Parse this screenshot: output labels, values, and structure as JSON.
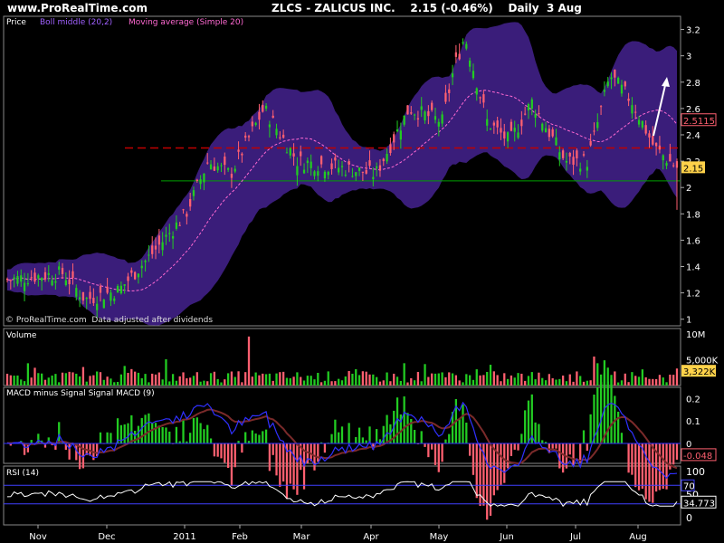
{
  "header": {
    "site": "www.ProRealTime.com",
    "title": "ZLCS - ZALICUS INC.    2.15 (-0.46%)    Daily  3 Aug"
  },
  "panels": {
    "price": {
      "label": "Price",
      "legend": [
        "Boll middle (20,2)",
        "Moving average (Simple 20)"
      ],
      "footer": "© ProRealTime.com  Data adjusted after dividends",
      "last_value": "2.15",
      "boll_value": "2.5115",
      "yticks": [
        "3.2",
        "3",
        "2.8",
        "2.6",
        "2.4",
        "2.2",
        "2",
        "1.8",
        "1.6",
        "1.4",
        "1.2",
        "1"
      ]
    },
    "volume": {
      "label": "Volume",
      "scale_label": "10M",
      "scale_label2": "5,000K",
      "last_value": "3,322K"
    },
    "macd": {
      "label": "MACD minus Signal Signal MACD (9)",
      "yticks": [
        "0.2",
        "0.1",
        "0"
      ],
      "last_value": "-0.048"
    },
    "rsi": {
      "label": "RSI (14)",
      "yticks": [
        "100",
        "50",
        "0"
      ],
      "level_label": "70",
      "last_value": "34.773"
    },
    "xaxis": [
      "Nov",
      "Dec",
      "2011",
      "Feb",
      "Mar",
      "Apr",
      "May",
      "Jun",
      "Jul",
      "Aug"
    ]
  },
  "chart_data": {
    "type": "candlestick",
    "ylim": [
      0.95,
      3.3
    ],
    "hlines": [
      {
        "value": 2.3,
        "color": "#c00000",
        "style": "dashed"
      },
      {
        "value": 2.05,
        "color": "#00a000",
        "style": "solid"
      }
    ],
    "close_series_key_points": [
      {
        "date": "Nov",
        "close": 1.3
      },
      {
        "date": "mid Nov",
        "close": 1.2
      },
      {
        "date": "Dec",
        "close": 1.25
      },
      {
        "date": "mid Dec",
        "close": 1.45
      },
      {
        "date": "Jan",
        "close": 2.0
      },
      {
        "date": "Feb",
        "close": 2.3
      },
      {
        "date": "Mar",
        "close": 2.1
      },
      {
        "date": "Apr",
        "close": 2.3
      },
      {
        "date": "late Apr",
        "close": 3.1
      },
      {
        "date": "May",
        "close": 2.5
      },
      {
        "date": "Jun",
        "close": 2.3
      },
      {
        "date": "Jul",
        "close": 2.8
      },
      {
        "date": "Aug",
        "close": 2.15
      }
    ],
    "colors": {
      "up": "#22cc22",
      "down": "#ff6070",
      "bollinger_fill": "#3a1d7a",
      "ma": "#ff69d2",
      "macd_line": "#3030ff",
      "signal": "#7a2a2a",
      "rsi_line": "#ffffff"
    }
  }
}
